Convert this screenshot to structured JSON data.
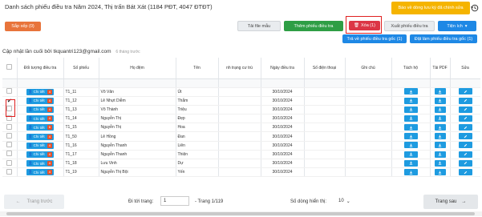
{
  "header": {
    "title": "Danh sách phiếu điều tra Năm 2024, Thị trấn Bát Xát (1184 PĐT, 4047 ĐTĐT)"
  },
  "toolbar": {
    "sort_label": "Sắp xếp (0)",
    "download_template_label": "Tải file mẫu",
    "add_form_label": "Thêm phiếu điều tra",
    "delete_label": "Xóa (1)",
    "export_label": "Xuất phiếu điều tra",
    "utilities_label": "Tiện ích",
    "return_label": "Trả về phiếu điều tra gốc (1)",
    "reset_label": "Đặt làm phiếu điều tra gốc (1)",
    "notify_label": "Báo về dòng lưu kỳ đã chính sửa"
  },
  "last_update": {
    "text": "Cập nhật lần cuối bởi tkquantri123@gmail.com",
    "ago": "6 tháng trước"
  },
  "table": {
    "headers": [
      "",
      "Đối tượng điều tra",
      "Số phiếu",
      "Họ đệm",
      "Tên",
      "nh trạng cư trú",
      "Ngày điều tra",
      "Số điện thoại",
      "Ghi chú",
      "Tách hộ",
      "Tải PDF",
      "Sửa"
    ],
    "detail_label": "Chi tiết",
    "rows": [
      {
        "badge": "4",
        "so_phieu": "T1_11",
        "ho_dem": "Võ Văn",
        "ten": "Út",
        "ngay": "30/10/2024",
        "checked": false
      },
      {
        "badge": "4",
        "so_phieu": "T1_12",
        "ho_dem": "Lê Nhựt Diễm",
        "ten": "Thắm",
        "ngay": "30/10/2024",
        "checked": true
      },
      {
        "badge": "4",
        "so_phieu": "T1_13",
        "ho_dem": "Võ Thành",
        "ten": "Triệu",
        "ngay": "30/10/2024",
        "checked": false
      },
      {
        "badge": "4",
        "so_phieu": "T1_14",
        "ho_dem": "Nguyễn Thị",
        "ten": "Đẹp",
        "ngay": "30/10/2024",
        "checked": false
      },
      {
        "badge": "6",
        "so_phieu": "T1_15",
        "ho_dem": "Nguyễn Thị",
        "ten": "Hoa",
        "ngay": "30/10/2024",
        "checked": false
      },
      {
        "badge": "4",
        "so_phieu": "T1_50",
        "ho_dem": "Lê Hồng",
        "ten": "Đan",
        "ngay": "30/10/2024",
        "checked": false
      },
      {
        "badge": "4",
        "so_phieu": "T1_16",
        "ho_dem": "Nguyễn Thanh",
        "ten": "Liên",
        "ngay": "30/10/2024",
        "checked": false
      },
      {
        "badge": "4",
        "so_phieu": "T1_17",
        "ho_dem": "Nguyễn Thanh",
        "ten": "Thiện",
        "ngay": "30/10/2024",
        "checked": false
      },
      {
        "badge": "4",
        "so_phieu": "T1_18",
        "ho_dem": "Lưu Vinh",
        "ten": "Dự",
        "ngay": "30/10/2024",
        "checked": false
      },
      {
        "badge": "4",
        "so_phieu": "T1_19",
        "ho_dem": "Nguyễn Thị Bội",
        "ten": "Yến",
        "ngay": "30/10/2024",
        "checked": false
      }
    ]
  },
  "pager": {
    "prev_label": "Trang trước",
    "goto_label": "Đi tới trang:",
    "page_input": "1",
    "page_info": "- Trang 1/119",
    "rows_label": "Số dòng hiển thị:",
    "rows_value": "10",
    "next_label": "Trang sau"
  },
  "colors": {
    "accent_blue": "#1e9be0",
    "badge_orange": "#e8512a",
    "delete_red": "#dc3545",
    "add_green": "#2e9e45",
    "highlight_red": "#e02020"
  }
}
